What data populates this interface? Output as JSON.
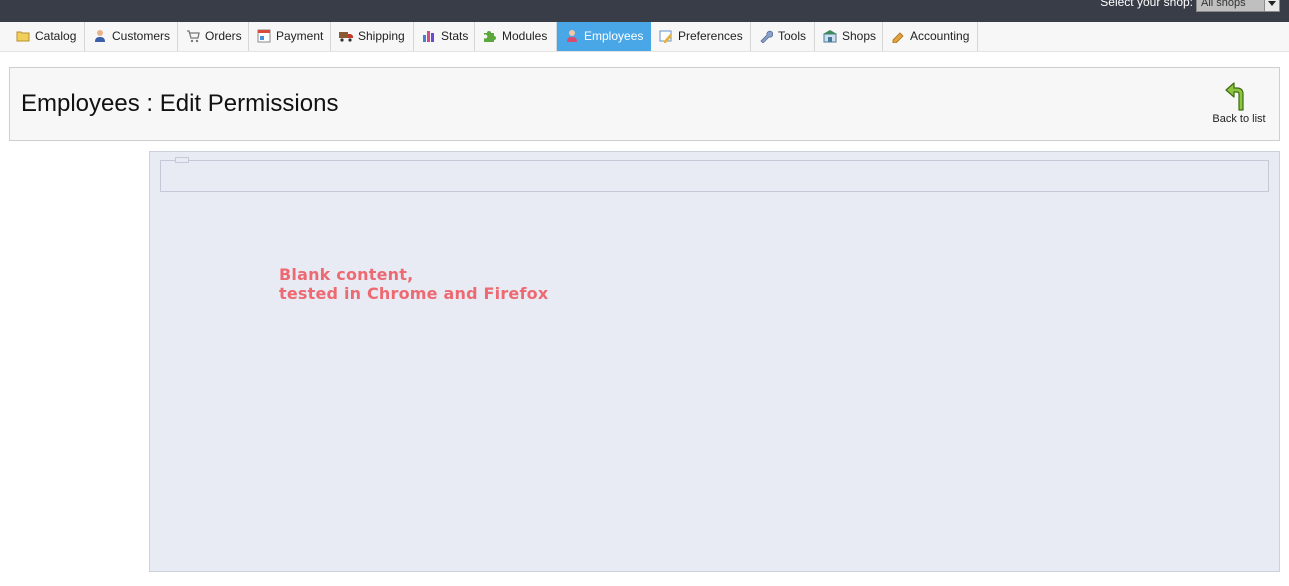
{
  "header": {
    "shop_label": "Select your shop:",
    "shop_selected": "All shops"
  },
  "tabs": [
    {
      "label": "Catalog",
      "icon": "folder-icon"
    },
    {
      "label": "Customers",
      "icon": "customer-icon"
    },
    {
      "label": "Orders",
      "icon": "cart-icon"
    },
    {
      "label": "Payment",
      "icon": "payment-icon"
    },
    {
      "label": "Shipping",
      "icon": "truck-icon"
    },
    {
      "label": "Stats",
      "icon": "bar-chart-icon"
    },
    {
      "label": "Modules",
      "icon": "puzzle-icon"
    },
    {
      "label": "Employees",
      "icon": "employee-icon",
      "active": true
    },
    {
      "label": "Preferences",
      "icon": "preferences-icon"
    },
    {
      "label": "Tools",
      "icon": "wrench-icon"
    },
    {
      "label": "Shops",
      "icon": "shop-icon"
    },
    {
      "label": "Accounting",
      "icon": "pencil-icon"
    }
  ],
  "page": {
    "title": "Employees : Edit Permissions",
    "back_label": "Back to list"
  },
  "content": {
    "note_line1": "Blank content,",
    "note_line2": "tested in Chrome and Firefox"
  },
  "colors": {
    "header_bg": "#383d47",
    "active_tab": "#49a7e7",
    "content_bg": "#e8ebf3",
    "note_text": "#ee6a72"
  }
}
